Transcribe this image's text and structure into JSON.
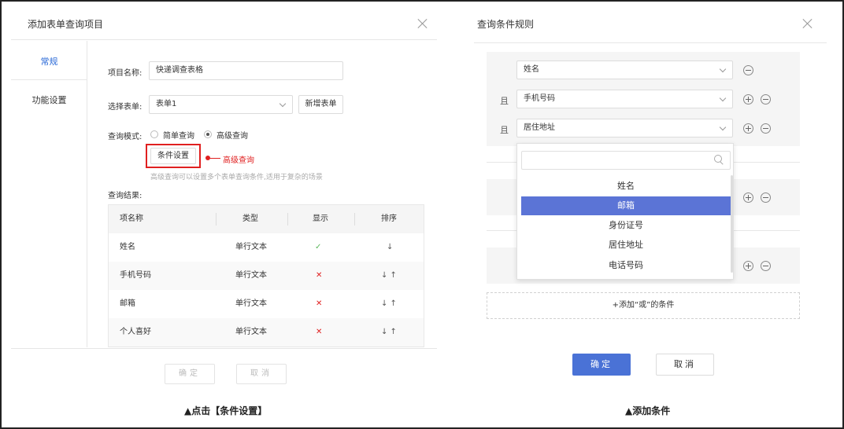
{
  "left_dialog": {
    "title": "添加表单查询项目",
    "nav": {
      "items": [
        "常规",
        "功能设置"
      ],
      "active": "常规"
    },
    "project_name": {
      "label": "项目名称:",
      "value": "快递调查表格"
    },
    "form_select": {
      "label": "选择表单:",
      "value": "表单1",
      "new_button": "新增表单"
    },
    "query_mode": {
      "label": "查询模式:",
      "options": [
        "简单查询",
        "高级查询"
      ],
      "selected": "高级查询"
    },
    "condition_button": "条件设置",
    "annotation": "高级查询",
    "hint": "高级查询可以设置多个表单查询条件,适用于复杂的场景",
    "results_label": "查询结果:",
    "table": {
      "headers": [
        "项名称",
        "类型",
        "显示",
        "排序"
      ],
      "rows": [
        {
          "name": "姓名",
          "type": "单行文本",
          "display": "✓",
          "sort": "↓"
        },
        {
          "name": "手机号码",
          "type": "单行文本",
          "display": "✕",
          "sort": "↓ ↑"
        },
        {
          "name": "邮箱",
          "type": "单行文本",
          "display": "✕",
          "sort": "↓ ↑"
        },
        {
          "name": "个人喜好",
          "type": "单行文本",
          "display": "✕",
          "sort": "↓ ↑"
        }
      ]
    },
    "confirm_label": "确定",
    "cancel_label": "取消",
    "caption": "▲点击【条件设置】"
  },
  "right_dialog": {
    "title": "查询条件规则",
    "and_label": "且",
    "conditions": [
      "姓名",
      "手机号码",
      "居住地址"
    ],
    "dropdown_options": [
      "姓名",
      "邮箱",
      "身份证号",
      "居住地址",
      "电话号码"
    ],
    "dropdown_selected": "邮箱",
    "add_or": "+添加“或”的条件",
    "confirm_label": "确定",
    "cancel_label": "取消",
    "caption": "▲添加条件"
  },
  "colors": {
    "accent": "#4a72d6",
    "annotation_red": "#e02020",
    "check_green": "#5cb85c",
    "selected_option": "#5b74d6"
  }
}
